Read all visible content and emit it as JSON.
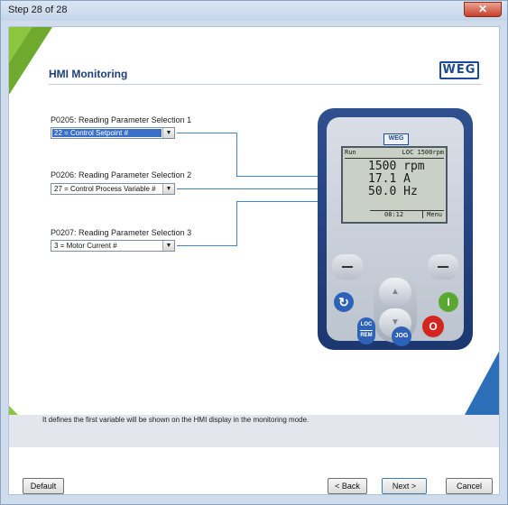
{
  "window": {
    "title": "Step 28 of 28",
    "close_glyph": "✕"
  },
  "page": {
    "heading": "HMI Monitoring",
    "brand": "WEG"
  },
  "params": [
    {
      "label": "P0205: Reading Parameter Selection 1",
      "value": "22 = Control Setpoint #"
    },
    {
      "label": "P0206: Reading Parameter Selection 2",
      "value": "27 = Control Process Variable #"
    },
    {
      "label": "P0207: Reading Parameter Selection 3",
      "value": "3 = Motor Current #"
    }
  ],
  "hmi": {
    "logo": "WEG",
    "status_left": "Run",
    "status_right": "LOC 1500rpm",
    "line1": "1500 rpm",
    "line2": "17.1 A",
    "line3": "50.0 Hz",
    "time": "08:12",
    "menu": "Menu",
    "loc_label": "LOC",
    "rem_label": "REM",
    "jog_label": "JOG",
    "start_glyph": "I",
    "stop_glyph": "O",
    "up_glyph": "▲",
    "down_glyph": "▼",
    "rotate_glyph": "↻"
  },
  "description": "It defines the first variable will be shown on the HMI display in the monitoring mode.",
  "buttons": {
    "default": "Default",
    "back": "< Back",
    "next": "Next >",
    "cancel": "Cancel"
  },
  "colors": {
    "accent": "#1f3f7a",
    "line": "#3c88c8",
    "hmi_body": "#2f4f8e",
    "green": "#5aa832",
    "blue_button": "#2e62b9",
    "stop_red": "#d2261f"
  }
}
